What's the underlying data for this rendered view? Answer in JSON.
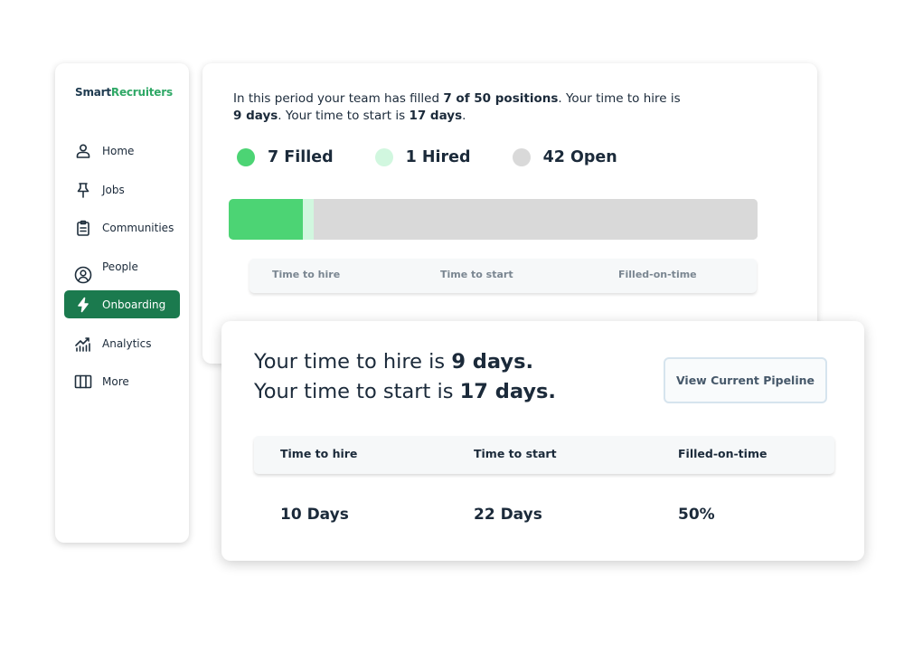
{
  "sidebar": {
    "logo": {
      "part1": "Smart",
      "part2": "Recruiters"
    },
    "items": [
      {
        "label": "Home",
        "icon": "person-icon"
      },
      {
        "label": "Jobs",
        "icon": "pin-icon"
      },
      {
        "label": "Communities",
        "icon": "clipboard-icon"
      },
      {
        "label": "People",
        "icon": "user-circle-icon"
      },
      {
        "label": "Onboarding",
        "icon": "lightning-icon",
        "active": true
      },
      {
        "label": "Analytics",
        "icon": "analytics-icon"
      },
      {
        "label": "More",
        "icon": "columns-icon"
      }
    ]
  },
  "summary": {
    "part1": "In this period your team has filled ",
    "bold1": "7 of 50 positions",
    "part2": ". Your time to hire is ",
    "bold2": "9 days",
    "part3": ". Your time to start is ",
    "bold3": "17 days",
    "part4": "."
  },
  "legend": [
    {
      "label": "7 Filled",
      "color": "#4cd474",
      "value": 7
    },
    {
      "label": "1 Hired",
      "color": "#d1f7df",
      "value": 1
    },
    {
      "label": "42 Open",
      "color": "#d9d9d9",
      "value": 42
    }
  ],
  "progress": {
    "total": 50,
    "filled": 7,
    "hired": 1,
    "open": 42
  },
  "mini_table": {
    "headers": [
      "Time to hire",
      "Time to start",
      "Filled-on-time"
    ]
  },
  "front": {
    "line1": "Your time to hire is ",
    "line1_bold": "9 days.",
    "line2": "Your time to start is ",
    "line2_bold": "17 days.",
    "button_label": "View Current Pipeline",
    "headers": [
      "Time to hire",
      "Time to start",
      "Filled-on-time"
    ],
    "values": [
      "10 Days",
      "22 Days",
      "50%"
    ]
  },
  "colors": {
    "brand_green": "#1b7a4e",
    "logo_green": "#2fa866",
    "text_dark": "#1b2a3a"
  }
}
